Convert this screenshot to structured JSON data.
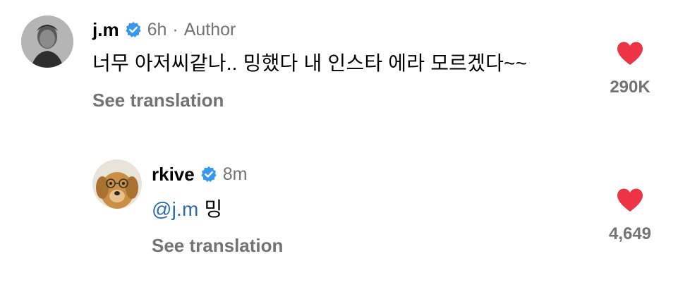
{
  "comments": [
    {
      "username": "j.m",
      "time": "6h",
      "role": "Author",
      "text": "너무 아저씨같나.. 밍했다 내 인스타 에라 모르겠다~~",
      "translate_label": "See translation",
      "likes": "290K",
      "verified": true,
      "liked": true
    },
    {
      "username": "rkive",
      "time": "8m",
      "mention": "@j.m",
      "text": "밍",
      "translate_label": "See translation",
      "likes": "4,649",
      "verified": true,
      "liked": true
    }
  ],
  "colors": {
    "verified_blue": "#3897f0",
    "heart_red": "#ed3447",
    "secondary_text": "#737373",
    "mention_blue": "#2b6ba8"
  },
  "icons": [
    "verified-badge-icon",
    "heart-icon"
  ]
}
